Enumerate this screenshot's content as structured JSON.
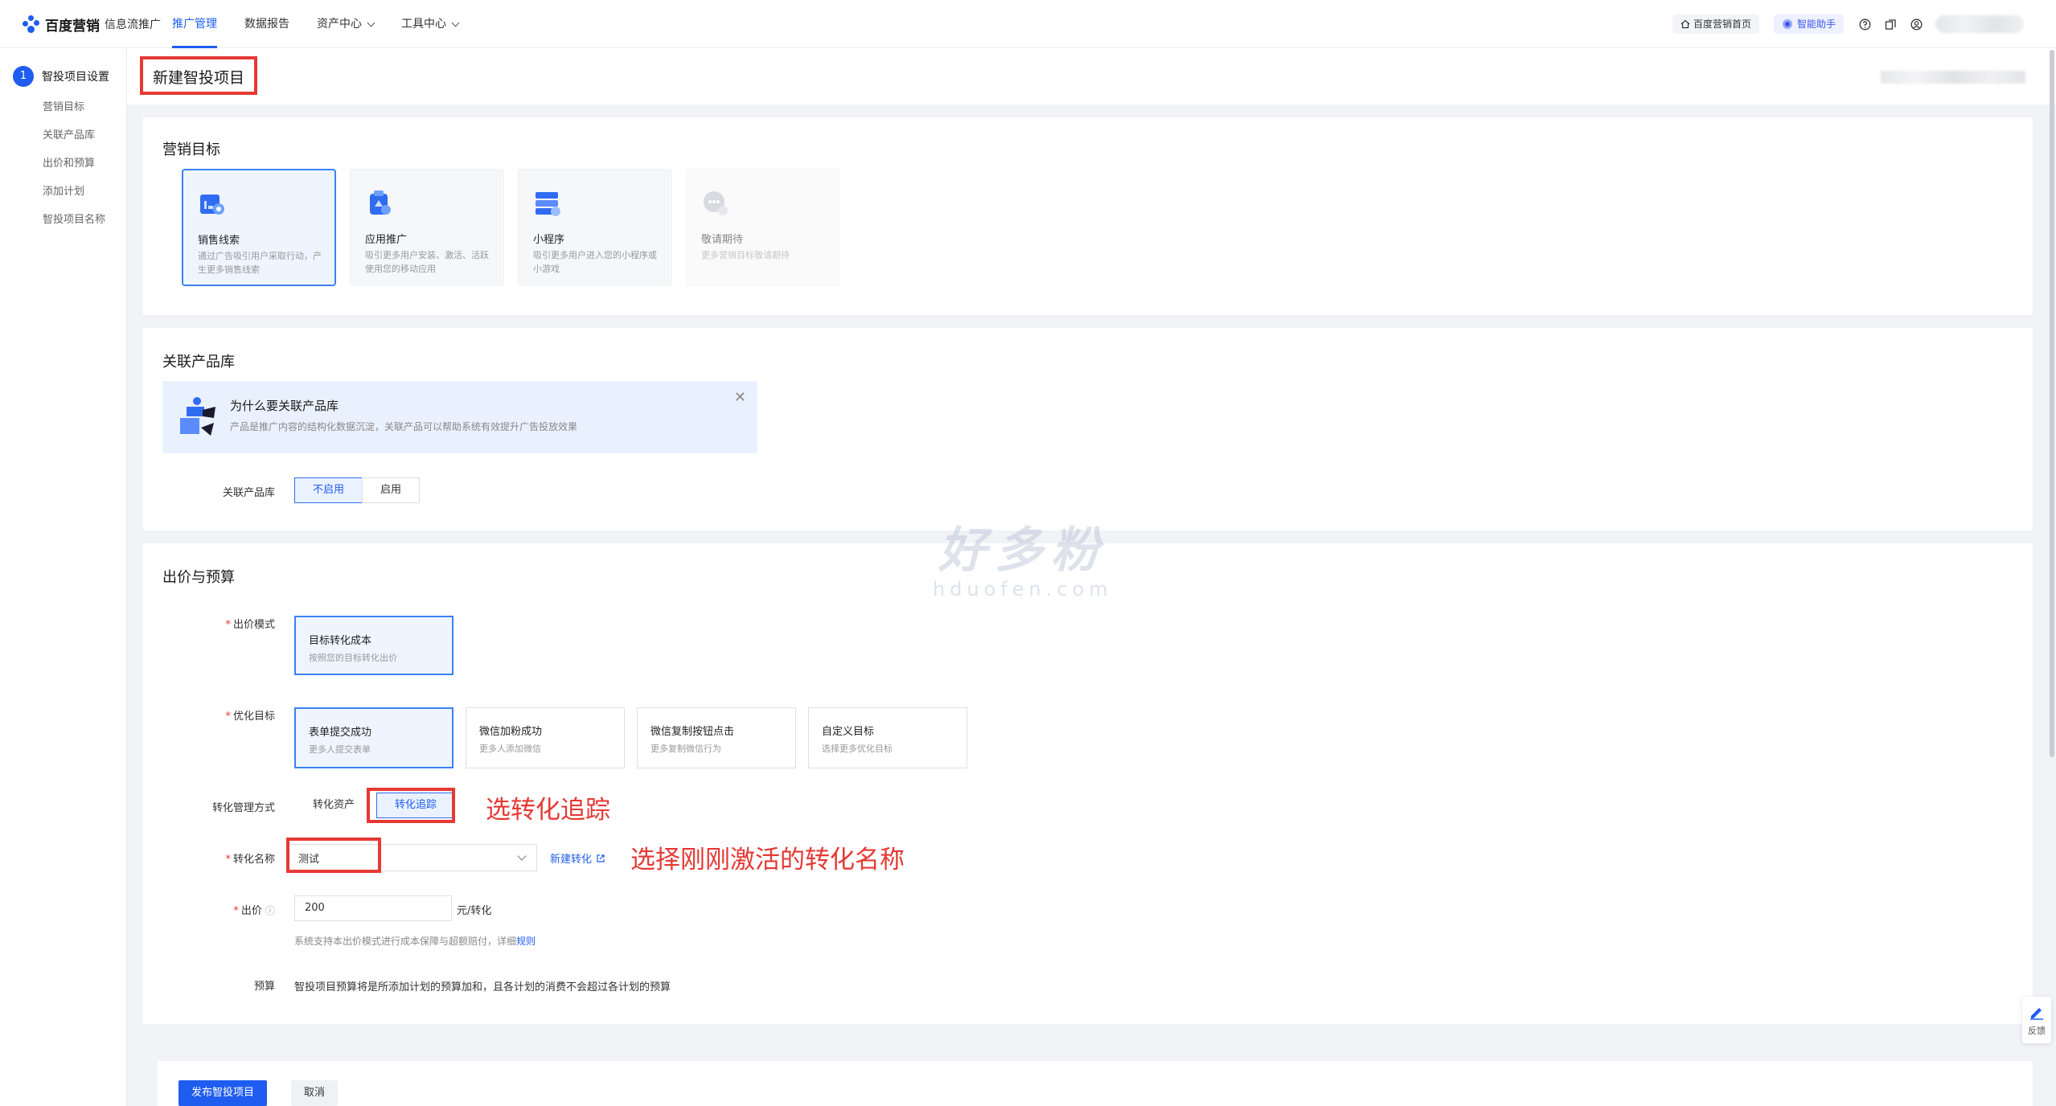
{
  "header": {
    "brand": "百度营销",
    "sub": "信息流推广",
    "nav": [
      {
        "label": "推广管理",
        "active": true,
        "dropdown": false
      },
      {
        "label": "数据报告",
        "active": false,
        "dropdown": false
      },
      {
        "label": "资产中心",
        "active": false,
        "dropdown": true
      },
      {
        "label": "工具中心",
        "active": false,
        "dropdown": true
      }
    ],
    "home_link": "百度营销首页",
    "assistant": "智能助手",
    "accent": "#1f5df0"
  },
  "sidebar": {
    "step_number": "1",
    "step_title": "智投项目设置",
    "items": [
      "营销目标",
      "关联产品库",
      "出价和预算",
      "添加计划",
      "智投项目名称"
    ]
  },
  "page": {
    "title": "新建智投项目"
  },
  "marketing": {
    "title": "营销目标",
    "goals": [
      {
        "name": "销售线索",
        "desc": "通过广告吸引用户采取行动，产生更多销售线索",
        "state": "selected",
        "icon": "sales-leads-icon"
      },
      {
        "name": "应用推广",
        "desc": "吸引更多用户安装、激活、活跃使用您的移动应用",
        "state": "normal",
        "icon": "app-promotion-icon"
      },
      {
        "name": "小程序",
        "desc": "吸引更多用户进入您的小程序或小游戏",
        "state": "normal",
        "icon": "mini-program-icon"
      },
      {
        "name": "敬请期待",
        "desc": "更多营销目标敬请期待",
        "state": "disabled",
        "icon": "coming-soon-icon"
      }
    ]
  },
  "product": {
    "title": "关联产品库",
    "alert_title": "为什么要关联产品库",
    "alert_desc": "产品是推广内容的结构化数据沉淀，关联产品可以帮助系统有效提升广告投放效果",
    "label": "关联产品库",
    "options": [
      "不启用",
      "启用"
    ],
    "selected": "不启用"
  },
  "bid": {
    "title": "出价与预算",
    "mode_label": "出价模式",
    "mode": {
      "name": "目标转化成本",
      "desc": "按照您的目标转化出价"
    },
    "goal_label": "优化目标",
    "goals": [
      {
        "name": "表单提交成功",
        "desc": "更多人提交表单",
        "on": true
      },
      {
        "name": "微信加粉成功",
        "desc": "更多人添加微信",
        "on": false
      },
      {
        "name": "微信复制按钮点击",
        "desc": "更多复制微信行为",
        "on": false
      },
      {
        "name": "自定义目标",
        "desc": "选择更多优化目标",
        "on": false
      }
    ],
    "conv_mgmt_label": "转化管理方式",
    "conv_mgmt_options": [
      "转化资产",
      "转化追踪"
    ],
    "conv_mgmt_selected": "转化追踪",
    "conv_name_label": "转化名称",
    "conv_name_value": "测试",
    "new_conv_link": "新建转化",
    "price_label": "出价",
    "price_value": "200",
    "price_unit": "元/转化",
    "price_hint": "系统支持本出价模式进行成本保障与超额赔付，详细",
    "price_hint_link": "规则",
    "budget_label": "预算",
    "budget_text": "智投项目预算将是所添加计划的预算加和，且各计划的消费不会超过各计划的预算"
  },
  "annotations": {
    "conv_tracking": "选转化追踪",
    "conv_name": "选择刚刚激活的转化名称",
    "color": "#e53935"
  },
  "footer": {
    "publish": "发布智投项目",
    "cancel": "取消"
  },
  "watermark": {
    "cn": "好多粉",
    "en": "hduofen.com"
  },
  "feedback": "反馈"
}
